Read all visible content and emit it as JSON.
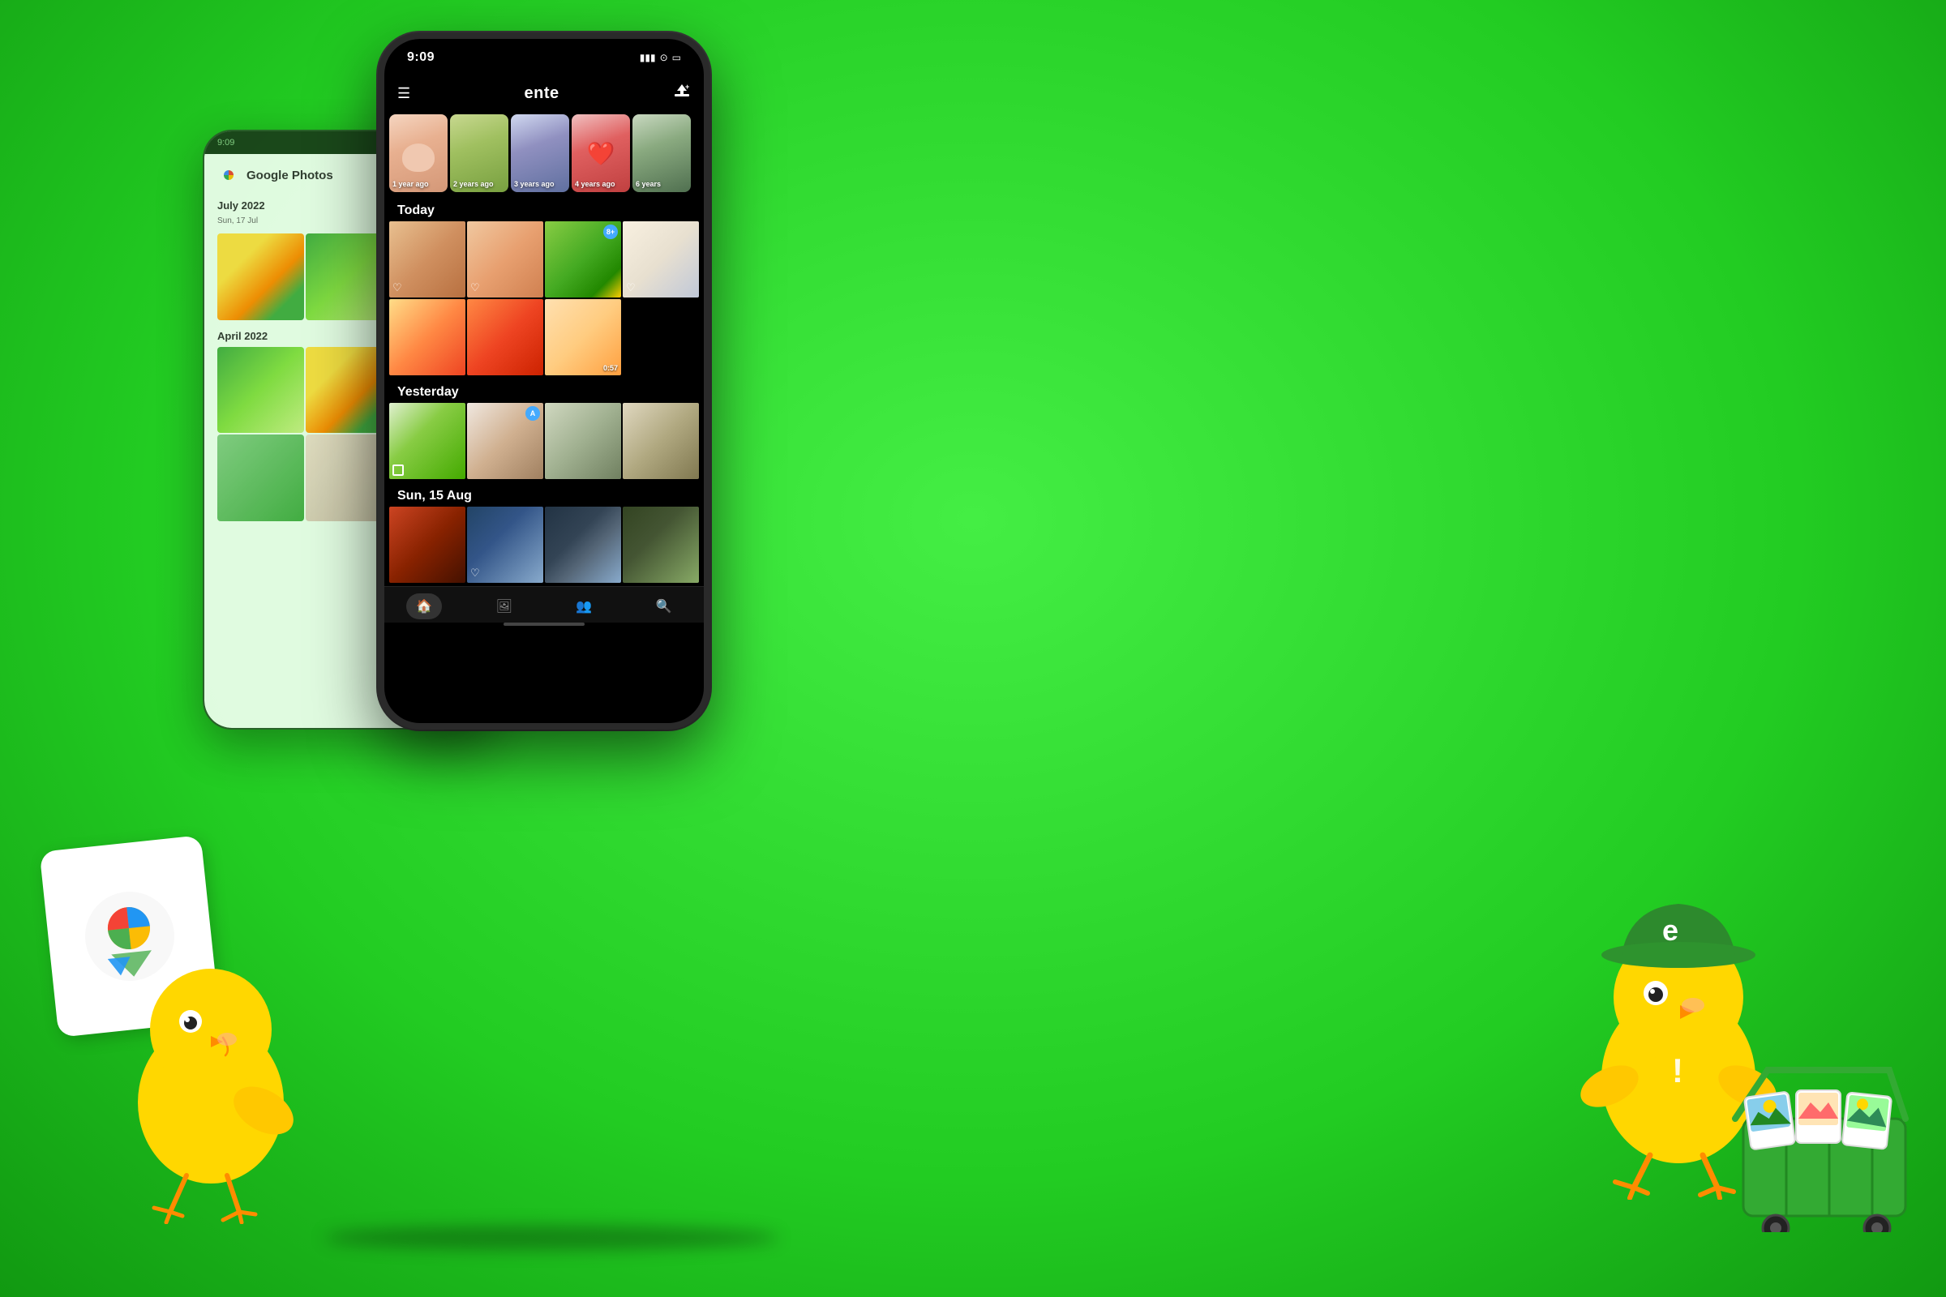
{
  "background": {
    "color": "#22dd22"
  },
  "back_phone": {
    "status_time": "9:09",
    "app_name": "Google Photos",
    "sections": [
      {
        "title": "July 2022",
        "subtitle": "Sun, 17 Jul"
      },
      {
        "title": "April 2022"
      }
    ]
  },
  "front_phone": {
    "status_time": "9:09",
    "app_title": "ente",
    "nav": {
      "hamburger": "☰",
      "upload": "⬆"
    },
    "memories": [
      {
        "label": "1 year ago"
      },
      {
        "label": "2 years ago"
      },
      {
        "label": "3 years ago"
      },
      {
        "label": "4 years ago"
      },
      {
        "label": "6 years"
      }
    ],
    "sections": [
      {
        "title": "Today",
        "rows": [
          [
            "family-party",
            "woman-curly",
            "birthday-table",
            "wedding-cake"
          ],
          [
            "baby-birthday",
            "girl-pink",
            "girl-balloons",
            null
          ]
        ]
      },
      {
        "title": "Yesterday",
        "rows": [
          [
            "woman-field",
            "girl-white",
            "couple-walk",
            "man-phone"
          ]
        ]
      },
      {
        "title": "Sun, 15 Aug",
        "rows": [
          [
            "red-poppies",
            "boy-river",
            "forest-dark",
            "family-walk"
          ]
        ]
      }
    ],
    "bottom_nav": [
      {
        "icon": "🏠",
        "active": true
      },
      {
        "icon": "🖼",
        "active": false
      },
      {
        "icon": "👥",
        "active": false
      },
      {
        "icon": "🔍",
        "active": false
      }
    ]
  },
  "left_mascot": {
    "card_label": "Google Photos"
  },
  "right_mascot": {
    "hat_letter": "e"
  }
}
